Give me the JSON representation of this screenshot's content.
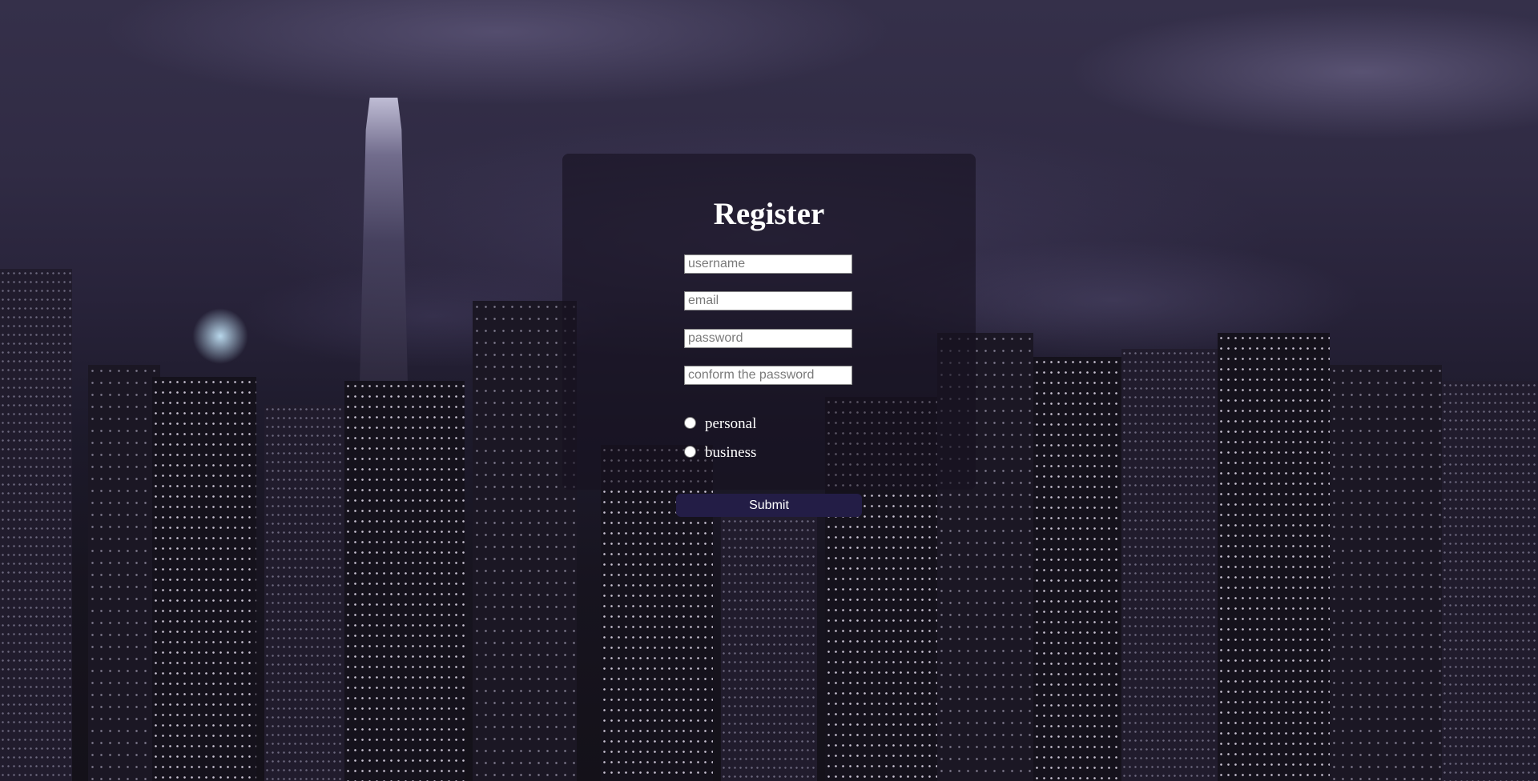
{
  "form": {
    "title": "Register",
    "fields": {
      "username_placeholder": "username",
      "email_placeholder": "email",
      "password_placeholder": "password",
      "confirm_placeholder": "conform the password"
    },
    "account_type": {
      "options": [
        "personal",
        "business"
      ],
      "selected": null
    },
    "submit_label": "Submit"
  },
  "colors": {
    "panel": "#161220",
    "submit_button": "#231d46",
    "text": "#ffffff"
  }
}
